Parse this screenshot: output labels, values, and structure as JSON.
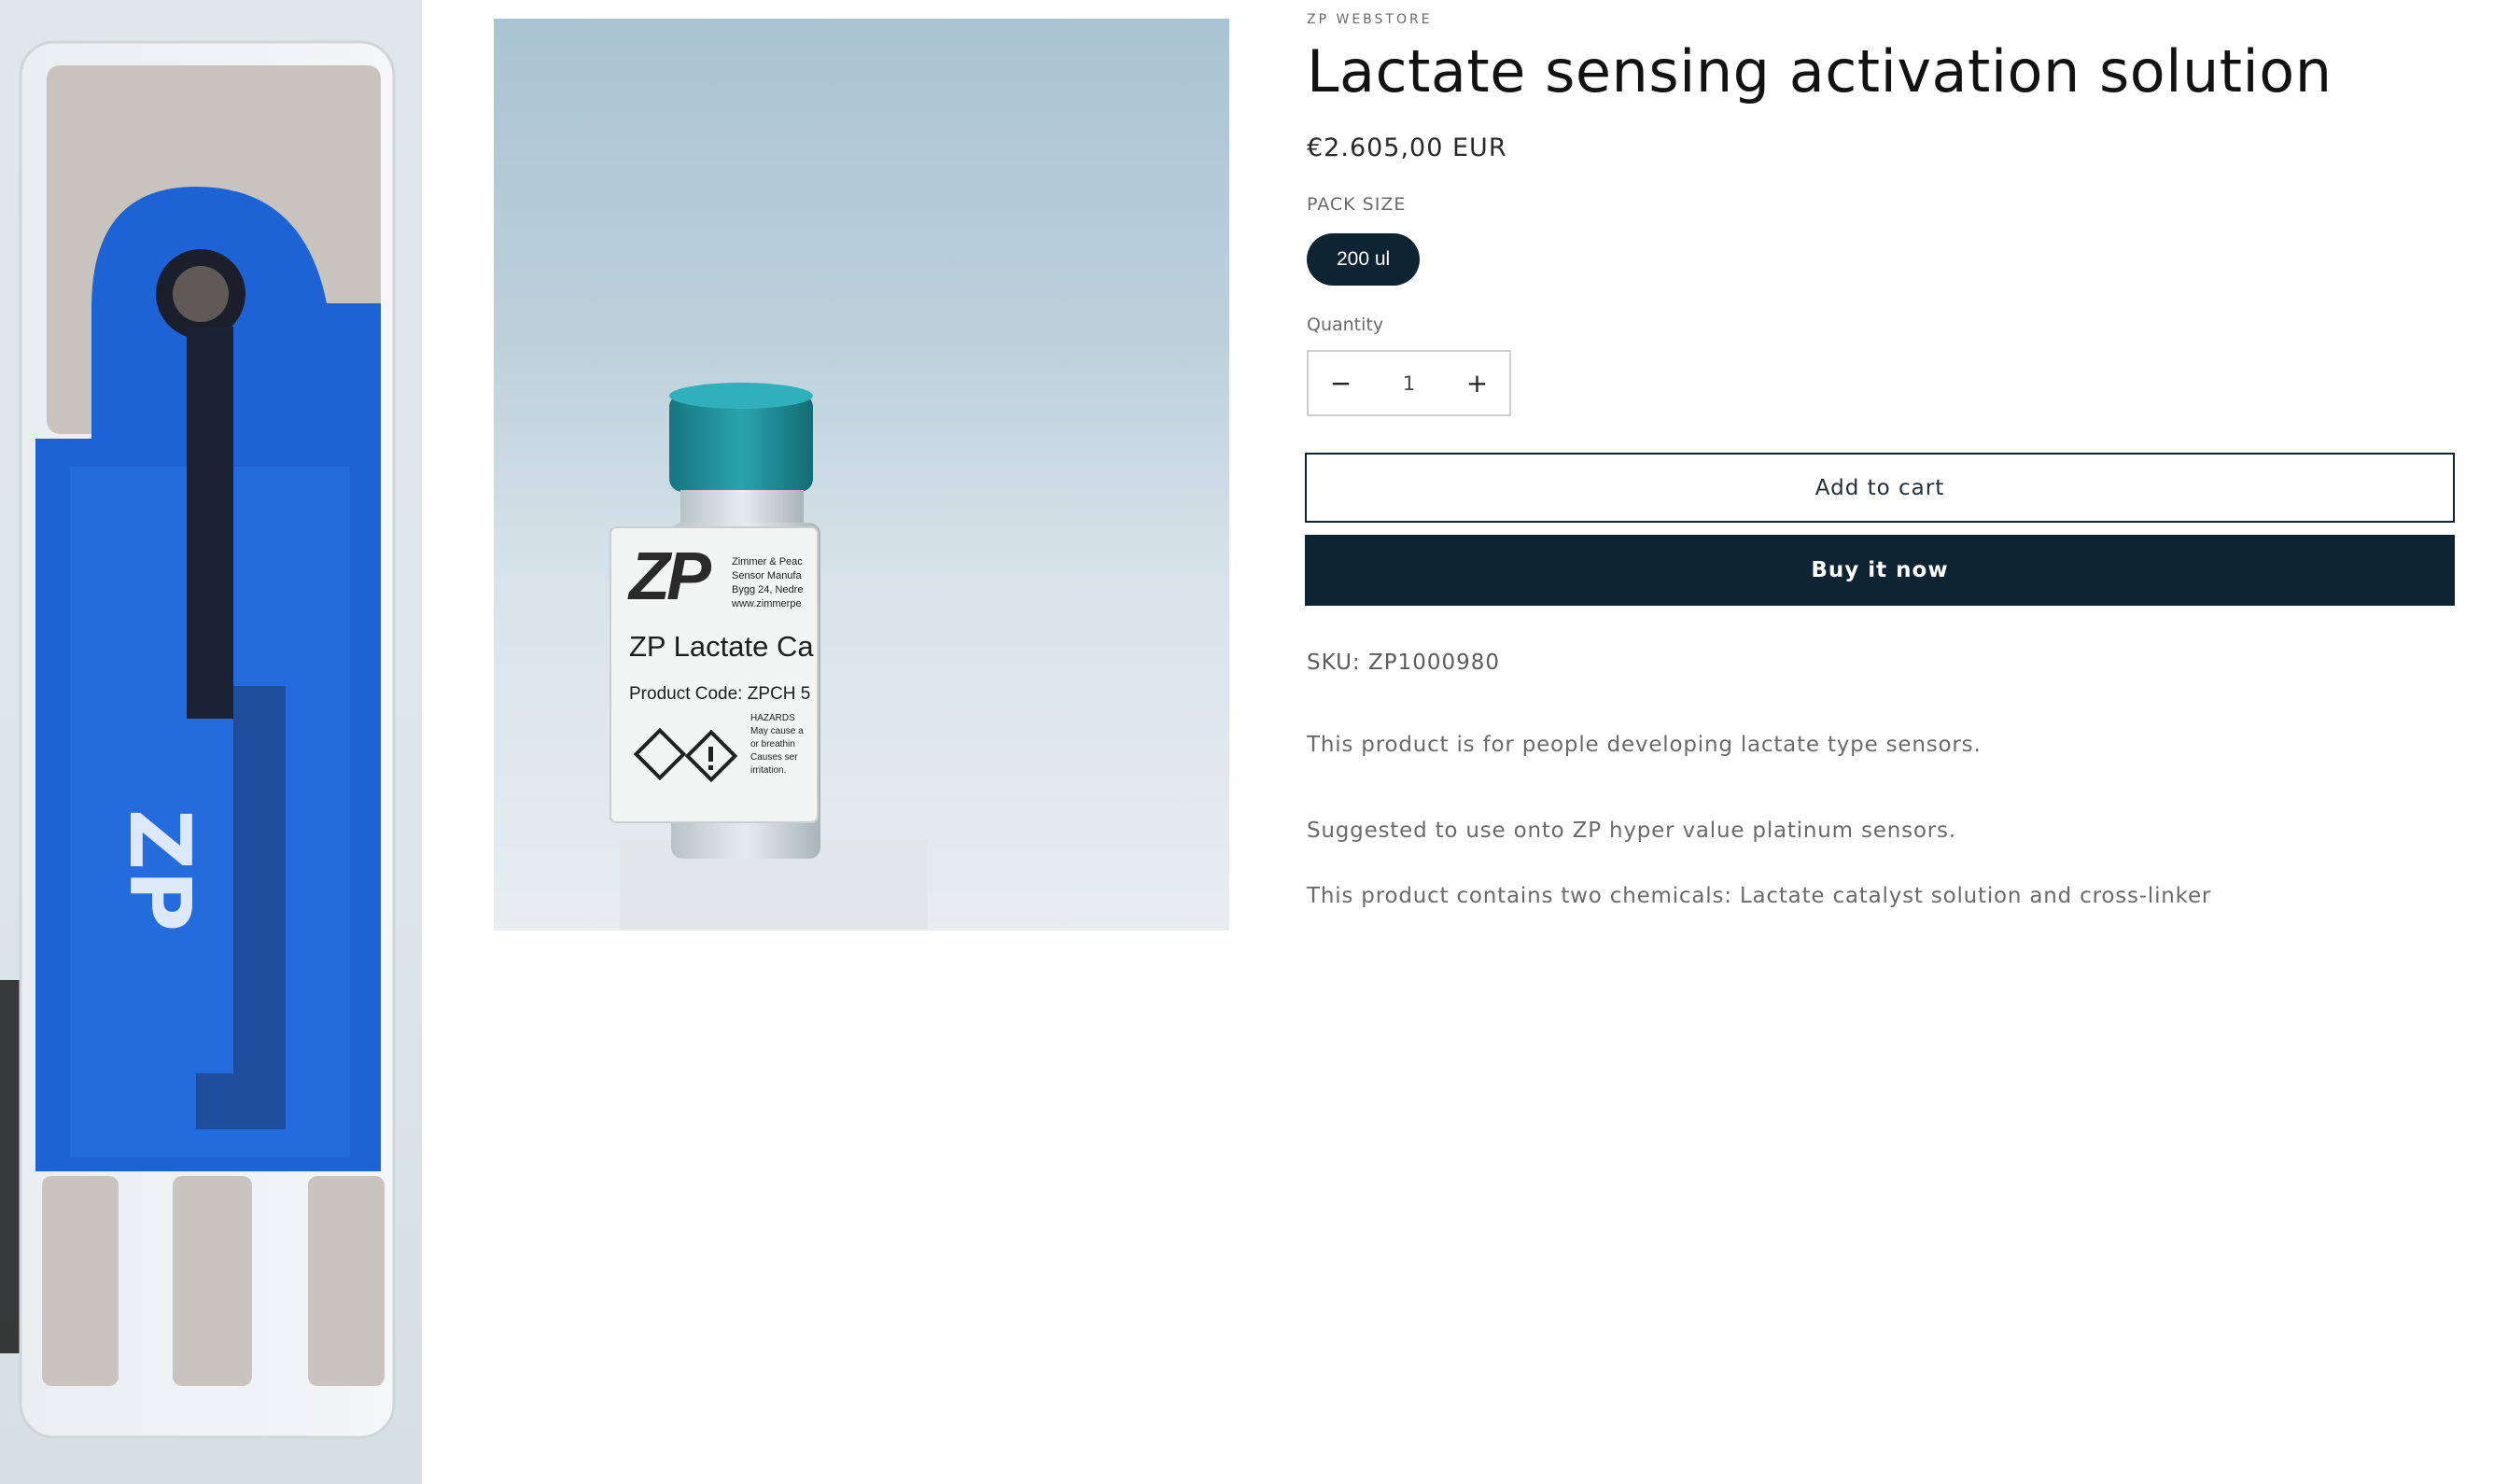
{
  "gallery": {
    "sensor_strip_logo": "ZP",
    "vial_label": {
      "brand": "ZP",
      "maker_lines": [
        "Zimmer & Peac",
        "Sensor Manufa",
        "Bygg 24, Nedre",
        "www.zimmerpe"
      ],
      "product_line": "ZP Lactate Ca",
      "code_line": "Product Code: ZPCH 5",
      "hazard_lines": [
        "HAZARDS",
        "May cause a",
        "or breathin",
        "Causes ser",
        "irritation."
      ]
    }
  },
  "product": {
    "vendor": "ZP WEBSTORE",
    "title": "Lactate sensing activation solution",
    "price": "€2.605,00 EUR",
    "pack_size_label": "PACK SIZE",
    "pack_size_option": "200 ul",
    "quantity_label": "Quantity",
    "quantity_value": "1",
    "decrease_symbol": "−",
    "increase_symbol": "+",
    "add_to_cart": "Add to cart",
    "buy_now": "Buy it now",
    "sku": "SKU: ZP1000980",
    "description": [
      "This product is for people developing lactate type sensors.",
      "Suggested to use onto ZP hyper value platinum sensors.",
      "This product contains two chemicals: Lactate catalyst solution and cross-linker"
    ]
  },
  "colors": {
    "accent_dark": "#0e2433",
    "sensor_blue": "#1a5fd0",
    "vial_cap": "#1f8a95"
  }
}
